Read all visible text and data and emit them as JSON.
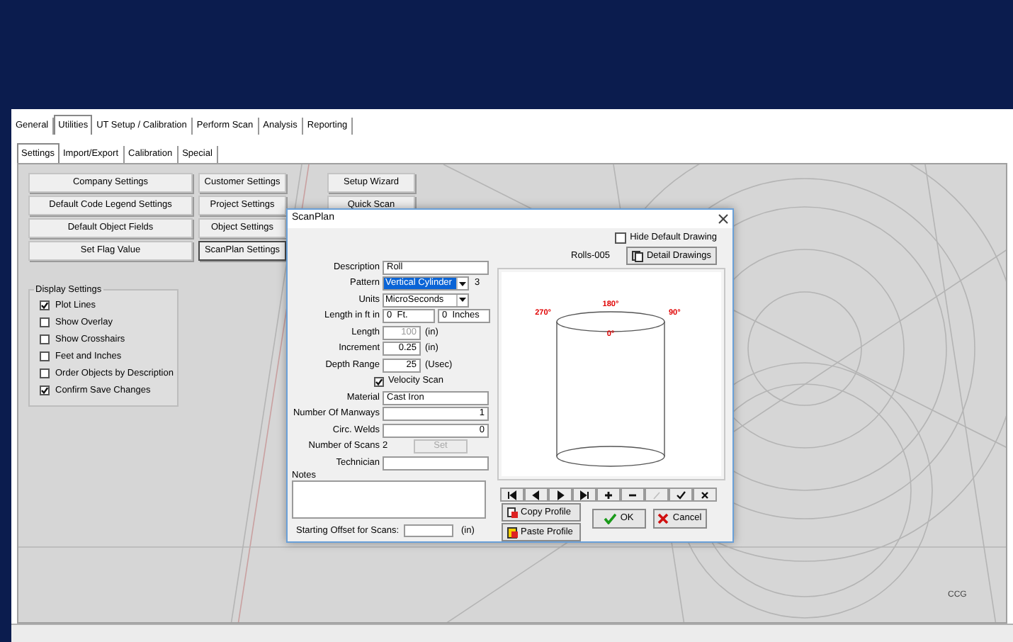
{
  "main_tabs": [
    {
      "label": "General",
      "selected": false
    },
    {
      "label": "Utilities",
      "selected": true
    },
    {
      "label": "UT Setup / Calibration",
      "selected": false
    },
    {
      "label": "Perform Scan",
      "selected": false
    },
    {
      "label": "Analysis",
      "selected": false
    },
    {
      "label": "Reporting",
      "selected": false
    }
  ],
  "sub_tabs": [
    {
      "label": "Settings",
      "selected": true
    },
    {
      "label": "Import/Export",
      "selected": false
    },
    {
      "label": "Calibration",
      "selected": false
    },
    {
      "label": "Special",
      "selected": false
    }
  ],
  "button_groups": [
    {
      "buttons": [
        {
          "label": "Company Settings",
          "focused": false
        },
        {
          "label": "Default Code Legend Settings",
          "focused": false
        },
        {
          "label": "Default Object Fields",
          "focused": false
        },
        {
          "label": "Set Flag Value",
          "focused": false
        }
      ]
    },
    {
      "buttons": [
        {
          "label": "Customer Settings",
          "focused": false
        },
        {
          "label": "Project Settings",
          "focused": false
        },
        {
          "label": "Object Settings",
          "focused": false
        },
        {
          "label": "ScanPlan Settings",
          "focused": true
        }
      ]
    },
    {
      "buttons": [
        {
          "label": "Setup Wizard",
          "focused": false
        },
        {
          "label": "Quick Scan",
          "focused": false
        }
      ]
    }
  ],
  "display_settings": {
    "title": "Display Settings",
    "options": [
      {
        "label": "Plot Lines",
        "checked": true
      },
      {
        "label": "Show Overlay",
        "checked": false
      },
      {
        "label": "Show Crosshairs",
        "checked": false
      },
      {
        "label": "Feet and Inches",
        "checked": false
      },
      {
        "label": "Order Objects by Description",
        "checked": false
      },
      {
        "label": "Confirm Save Changes",
        "checked": true
      }
    ]
  },
  "canvas_label": "CCG",
  "dialog": {
    "title": "ScanPlan",
    "fields": [
      {
        "kind": "text",
        "label": "Description",
        "value": "Roll"
      },
      {
        "kind": "select",
        "label": "Pattern",
        "value": "Vertical Cylinder",
        "highlighted": true,
        "suffix": "3"
      },
      {
        "kind": "select",
        "label": "Units",
        "value": "MicroSeconds",
        "highlighted": false
      },
      {
        "kind": "pair",
        "label": "Length in ft in",
        "values": [
          "0  Ft.",
          "0  Inches"
        ]
      },
      {
        "kind": "unit",
        "label": "Length",
        "value": "100",
        "unit": "(in)",
        "disabled": true
      },
      {
        "kind": "unit",
        "label": "Increment",
        "value": "0.25",
        "unit": "(in)",
        "disabled": false
      },
      {
        "kind": "unit",
        "label": "Depth Range",
        "value": "25",
        "unit": "(Usec)",
        "disabled": false
      },
      {
        "kind": "check",
        "label": "Velocity Scan",
        "checked": true
      },
      {
        "kind": "text",
        "label": "Material",
        "value": "Cast Iron"
      },
      {
        "kind": "number",
        "label": "Number Of Manways",
        "value": "1"
      },
      {
        "kind": "number",
        "label": "Circ. Welds",
        "value": "0"
      },
      {
        "kind": "count",
        "label": "Number of Scans",
        "value": "2",
        "button": "Set",
        "disabled": true
      },
      {
        "kind": "text",
        "label": "Technician"
      }
    ],
    "notes_label": "Notes",
    "offset": {
      "label": "Starting Offset for Scans:",
      "unit": "(in)"
    },
    "hide_default_drawing": {
      "label": "Hide Default Drawing",
      "checked": false
    },
    "profile_name": "Rolls-005",
    "detail_button": "Detail Drawings",
    "angle_labels": [
      {
        "kind": "back",
        "text": "180°"
      },
      {
        "kind": "left",
        "text": "270°"
      },
      {
        "kind": "right",
        "text": "90°"
      },
      {
        "kind": "front",
        "text": "0°"
      }
    ],
    "nav_buttons": [
      {
        "kind": "first",
        "disabled": false
      },
      {
        "kind": "prev",
        "disabled": false
      },
      {
        "kind": "next",
        "disabled": false
      },
      {
        "kind": "last",
        "disabled": false
      },
      {
        "kind": "add",
        "disabled": false
      },
      {
        "kind": "remove",
        "disabled": false
      },
      {
        "kind": "edit",
        "disabled": true
      },
      {
        "kind": "post",
        "disabled": false
      },
      {
        "kind": "cancel",
        "disabled": false
      }
    ],
    "copy_button": "Copy Profile",
    "paste_button": "Paste Profile",
    "ok_button": "OK",
    "cancel_button": "Cancel"
  }
}
